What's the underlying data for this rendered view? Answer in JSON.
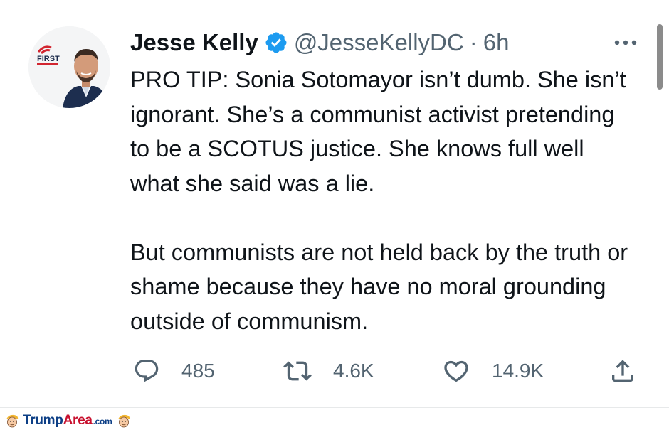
{
  "tweet": {
    "author_name": "Jesse Kelly",
    "handle": "@JesseKellyDC",
    "separator": "·",
    "time": "6h",
    "paragraphs": [
      "PRO TIP: Sonia Sotomayor isn’t dumb. She isn’t ignorant. She’s a communist activist pretending to be a SCOTUS justice. She knows full well what she said was a lie.",
      "But communists are not held back by the truth or shame because they have no moral grounding outside of communism."
    ],
    "avatar_badge": "FIRST",
    "verified": true
  },
  "actions": {
    "replies": "485",
    "retweets": "4.6K",
    "likes": "14.9K"
  },
  "watermark": {
    "part1": "Trump",
    "part2": "Area",
    "suffix": ".com"
  },
  "colors": {
    "text": "#0f1419",
    "muted": "#536471",
    "verified": "#1d9bf0",
    "divider": "#e7e9ea"
  },
  "icons": [
    "verified-badge-icon",
    "more-icon",
    "reply-icon",
    "retweet-icon",
    "like-icon",
    "share-icon"
  ]
}
